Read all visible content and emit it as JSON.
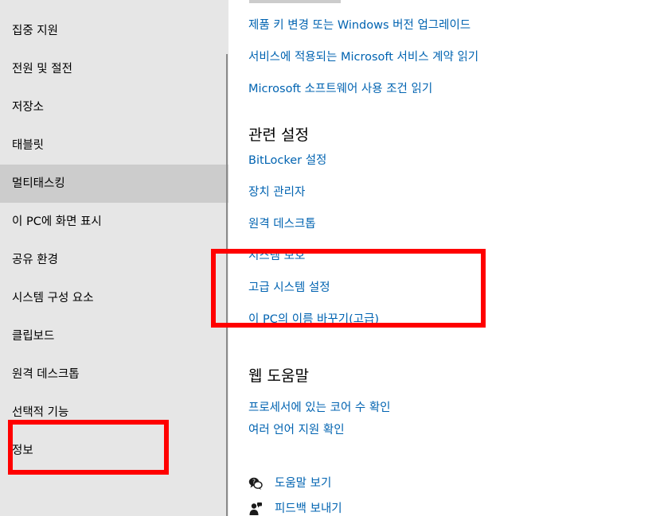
{
  "sidebar": {
    "items": [
      {
        "label": "집중 지원"
      },
      {
        "label": "전원 및 절전"
      },
      {
        "label": "저장소"
      },
      {
        "label": "태블릿"
      },
      {
        "label": "멀티태스킹"
      },
      {
        "label": "이 PC에 화면 표시"
      },
      {
        "label": "공유 환경"
      },
      {
        "label": "시스템 구성 요소"
      },
      {
        "label": "클립보드"
      },
      {
        "label": "원격 데스크톱"
      },
      {
        "label": "선택적 기능"
      },
      {
        "label": "정보"
      }
    ]
  },
  "main": {
    "top_links": [
      "제품 키 변경 또는 Windows 버전 업그레이드",
      "서비스에 적용되는 Microsoft 서비스 계약 읽기",
      "Microsoft 소프트웨어 사용 조건 읽기"
    ],
    "related_settings": {
      "title": "관련 설정",
      "links": [
        "BitLocker 설정",
        "장치 관리자",
        "원격 데스크톱",
        "시스템 보호",
        "고급 시스템 설정",
        "이 PC의 이름 바꾸기(고급)"
      ]
    },
    "web_help": {
      "title": "웹 도움말",
      "links": [
        "프로세서에 있는 코어 수 확인",
        "여러 언어 지원 확인"
      ]
    },
    "help": {
      "get_help": {
        "label": "도움말 보기",
        "icon": "chat-help-icon"
      },
      "feedback": {
        "label": "피드백 보내기",
        "icon": "feedback-icon"
      }
    }
  },
  "colors": {
    "sidebar_bg": "#e6e6e6",
    "sidebar_selected": "#cccccc",
    "link": "#0063b1",
    "annotation": "#ff0000"
  }
}
